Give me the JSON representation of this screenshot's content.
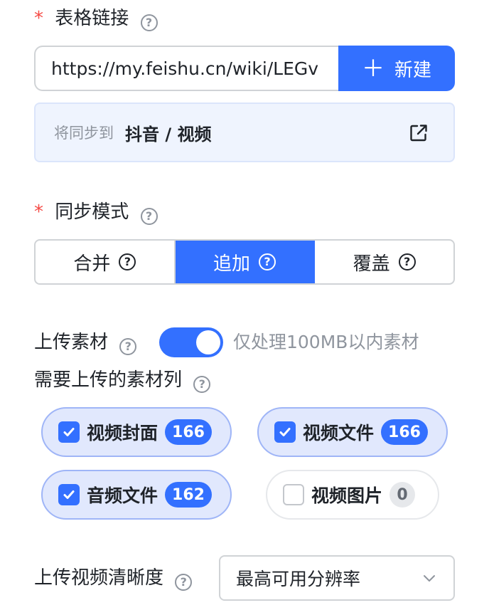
{
  "table_link": {
    "label": "表格链接",
    "required_mark": "*",
    "help_icon": "question-circle-icon",
    "url_value": "https://my.feishu.cn/wiki/LEGv",
    "new_button": {
      "icon": "plus-icon",
      "label": "新建"
    },
    "sync_prefix": "将同步到",
    "sync_path": "抖音 / 视频",
    "external_icon": "open-external-icon"
  },
  "sync_mode": {
    "label": "同步模式",
    "required_mark": "*",
    "options": [
      {
        "label": "合并",
        "selected": false
      },
      {
        "label": "追加",
        "selected": true
      },
      {
        "label": "覆盖",
        "selected": false
      }
    ]
  },
  "upload_material": {
    "label": "上传素材",
    "enabled": true,
    "hint": "仅处理100MB以内素材"
  },
  "material_columns": {
    "label": "需要上传的素材列",
    "items": [
      {
        "label": "视频封面",
        "count": "166",
        "checked": true
      },
      {
        "label": "视频文件",
        "count": "166",
        "checked": true
      },
      {
        "label": "音频文件",
        "count": "162",
        "checked": true
      },
      {
        "label": "视频图片",
        "count": "0",
        "checked": false
      }
    ]
  },
  "video_quality": {
    "label": "上传视频清晰度",
    "value": "最高可用分辨率",
    "icon": "chevron-down-icon"
  },
  "colors": {
    "accent": "#3370ff",
    "required": "#f54a45",
    "muted": "#8f959e"
  }
}
